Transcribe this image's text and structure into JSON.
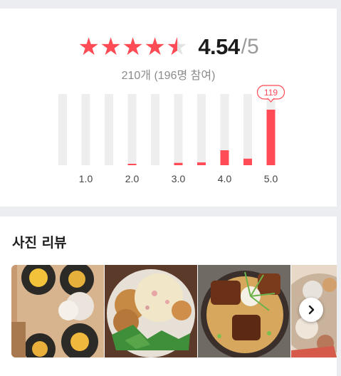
{
  "rating": {
    "score": "4.54",
    "max": "/5",
    "stars": [
      1,
      1,
      1,
      1,
      0.5
    ],
    "count_text": "210개 (196명 참여)"
  },
  "colors": {
    "accent": "#ff4b55",
    "track": "#eeeeee"
  },
  "chart_data": {
    "type": "bar",
    "categories": [
      "0.5",
      "1.0",
      "1.5",
      "2.0",
      "2.5",
      "3.0",
      "3.5",
      "4.0",
      "4.5",
      "5.0"
    ],
    "tick_labels": [
      "1.0",
      "2.0",
      "3.0",
      "4.0",
      "5.0"
    ],
    "values": [
      0,
      0,
      0,
      1,
      0,
      5,
      6,
      32,
      14,
      119
    ],
    "ylim": [
      0,
      119
    ],
    "highlight_label": "119"
  },
  "photo_review": {
    "title": "사진 리뷰",
    "photos": [
      {
        "icon": "kimbap-photo"
      },
      {
        "icon": "fried-chicken-salad-photo"
      },
      {
        "icon": "eel-rice-bowl-photo"
      },
      {
        "icon": "seafood-dish-photo"
      }
    ],
    "next_icon": "chevron-right-icon"
  }
}
